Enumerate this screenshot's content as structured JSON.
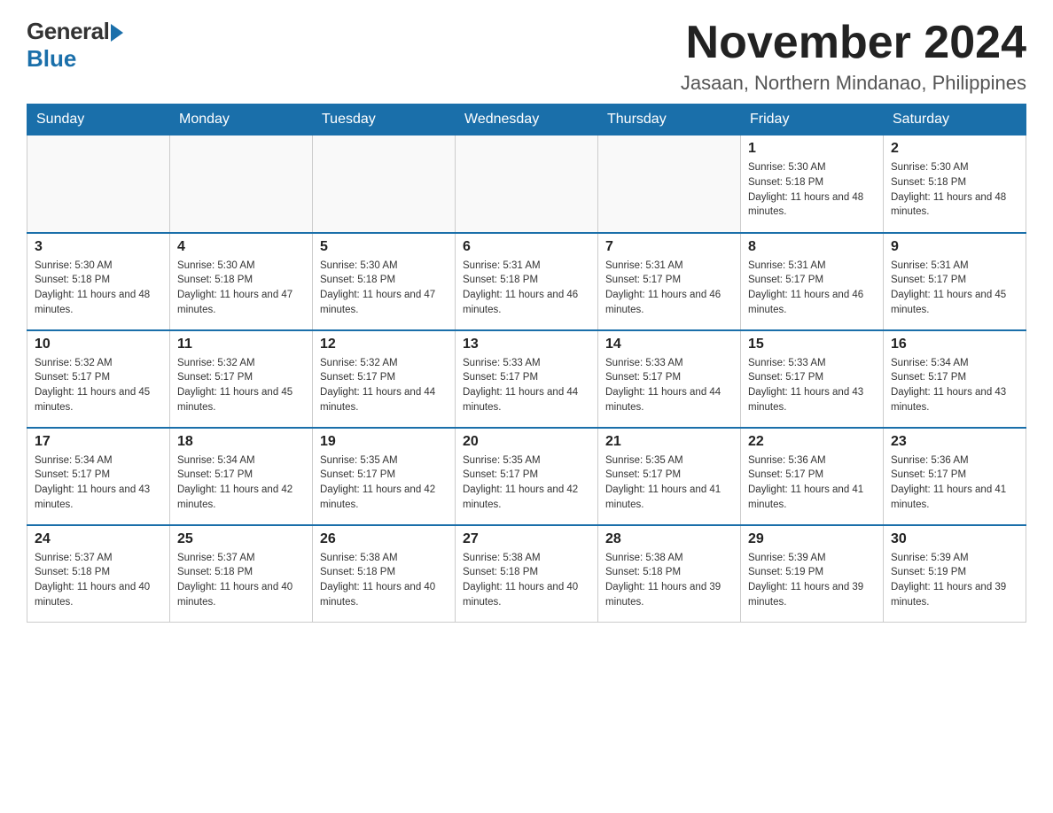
{
  "header": {
    "logo_general": "General",
    "logo_blue": "Blue",
    "month_title": "November 2024",
    "location": "Jasaan, Northern Mindanao, Philippines"
  },
  "weekdays": [
    "Sunday",
    "Monday",
    "Tuesday",
    "Wednesday",
    "Thursday",
    "Friday",
    "Saturday"
  ],
  "weeks": [
    [
      {
        "day": "",
        "info": ""
      },
      {
        "day": "",
        "info": ""
      },
      {
        "day": "",
        "info": ""
      },
      {
        "day": "",
        "info": ""
      },
      {
        "day": "",
        "info": ""
      },
      {
        "day": "1",
        "info": "Sunrise: 5:30 AM\nSunset: 5:18 PM\nDaylight: 11 hours and 48 minutes."
      },
      {
        "day": "2",
        "info": "Sunrise: 5:30 AM\nSunset: 5:18 PM\nDaylight: 11 hours and 48 minutes."
      }
    ],
    [
      {
        "day": "3",
        "info": "Sunrise: 5:30 AM\nSunset: 5:18 PM\nDaylight: 11 hours and 48 minutes."
      },
      {
        "day": "4",
        "info": "Sunrise: 5:30 AM\nSunset: 5:18 PM\nDaylight: 11 hours and 47 minutes."
      },
      {
        "day": "5",
        "info": "Sunrise: 5:30 AM\nSunset: 5:18 PM\nDaylight: 11 hours and 47 minutes."
      },
      {
        "day": "6",
        "info": "Sunrise: 5:31 AM\nSunset: 5:18 PM\nDaylight: 11 hours and 46 minutes."
      },
      {
        "day": "7",
        "info": "Sunrise: 5:31 AM\nSunset: 5:17 PM\nDaylight: 11 hours and 46 minutes."
      },
      {
        "day": "8",
        "info": "Sunrise: 5:31 AM\nSunset: 5:17 PM\nDaylight: 11 hours and 46 minutes."
      },
      {
        "day": "9",
        "info": "Sunrise: 5:31 AM\nSunset: 5:17 PM\nDaylight: 11 hours and 45 minutes."
      }
    ],
    [
      {
        "day": "10",
        "info": "Sunrise: 5:32 AM\nSunset: 5:17 PM\nDaylight: 11 hours and 45 minutes."
      },
      {
        "day": "11",
        "info": "Sunrise: 5:32 AM\nSunset: 5:17 PM\nDaylight: 11 hours and 45 minutes."
      },
      {
        "day": "12",
        "info": "Sunrise: 5:32 AM\nSunset: 5:17 PM\nDaylight: 11 hours and 44 minutes."
      },
      {
        "day": "13",
        "info": "Sunrise: 5:33 AM\nSunset: 5:17 PM\nDaylight: 11 hours and 44 minutes."
      },
      {
        "day": "14",
        "info": "Sunrise: 5:33 AM\nSunset: 5:17 PM\nDaylight: 11 hours and 44 minutes."
      },
      {
        "day": "15",
        "info": "Sunrise: 5:33 AM\nSunset: 5:17 PM\nDaylight: 11 hours and 43 minutes."
      },
      {
        "day": "16",
        "info": "Sunrise: 5:34 AM\nSunset: 5:17 PM\nDaylight: 11 hours and 43 minutes."
      }
    ],
    [
      {
        "day": "17",
        "info": "Sunrise: 5:34 AM\nSunset: 5:17 PM\nDaylight: 11 hours and 43 minutes."
      },
      {
        "day": "18",
        "info": "Sunrise: 5:34 AM\nSunset: 5:17 PM\nDaylight: 11 hours and 42 minutes."
      },
      {
        "day": "19",
        "info": "Sunrise: 5:35 AM\nSunset: 5:17 PM\nDaylight: 11 hours and 42 minutes."
      },
      {
        "day": "20",
        "info": "Sunrise: 5:35 AM\nSunset: 5:17 PM\nDaylight: 11 hours and 42 minutes."
      },
      {
        "day": "21",
        "info": "Sunrise: 5:35 AM\nSunset: 5:17 PM\nDaylight: 11 hours and 41 minutes."
      },
      {
        "day": "22",
        "info": "Sunrise: 5:36 AM\nSunset: 5:17 PM\nDaylight: 11 hours and 41 minutes."
      },
      {
        "day": "23",
        "info": "Sunrise: 5:36 AM\nSunset: 5:17 PM\nDaylight: 11 hours and 41 minutes."
      }
    ],
    [
      {
        "day": "24",
        "info": "Sunrise: 5:37 AM\nSunset: 5:18 PM\nDaylight: 11 hours and 40 minutes."
      },
      {
        "day": "25",
        "info": "Sunrise: 5:37 AM\nSunset: 5:18 PM\nDaylight: 11 hours and 40 minutes."
      },
      {
        "day": "26",
        "info": "Sunrise: 5:38 AM\nSunset: 5:18 PM\nDaylight: 11 hours and 40 minutes."
      },
      {
        "day": "27",
        "info": "Sunrise: 5:38 AM\nSunset: 5:18 PM\nDaylight: 11 hours and 40 minutes."
      },
      {
        "day": "28",
        "info": "Sunrise: 5:38 AM\nSunset: 5:18 PM\nDaylight: 11 hours and 39 minutes."
      },
      {
        "day": "29",
        "info": "Sunrise: 5:39 AM\nSunset: 5:19 PM\nDaylight: 11 hours and 39 minutes."
      },
      {
        "day": "30",
        "info": "Sunrise: 5:39 AM\nSunset: 5:19 PM\nDaylight: 11 hours and 39 minutes."
      }
    ]
  ]
}
